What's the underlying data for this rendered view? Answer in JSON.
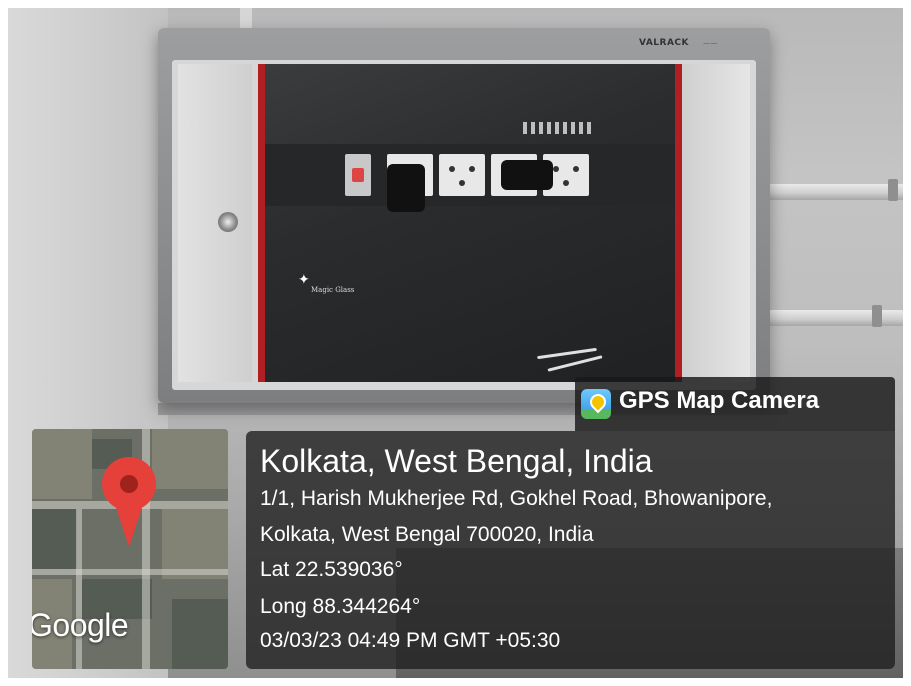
{
  "overlay": {
    "app_name": "GPS Map Camera",
    "app_icon": "gps-map-camera-icon",
    "location_title": "Kolkata, West Bengal, India",
    "address_line1": "1/1, Harish Mukherjee Rd, Gokhel Road, Bhowanipore,",
    "address_line2": "Kolkata, West Bengal 700020, India",
    "latitude": "Lat 22.539036°",
    "longitude": "Long 88.344264°",
    "datetime": "03/03/23 04:49 PM GMT +05:30"
  },
  "minimap": {
    "attribution": "Google",
    "marker_color": "#e5403a",
    "marker_icon": "map-pin-icon"
  },
  "photo": {
    "cabinet_brand": "VALRACK",
    "glass_logo": "Magic Glass"
  }
}
